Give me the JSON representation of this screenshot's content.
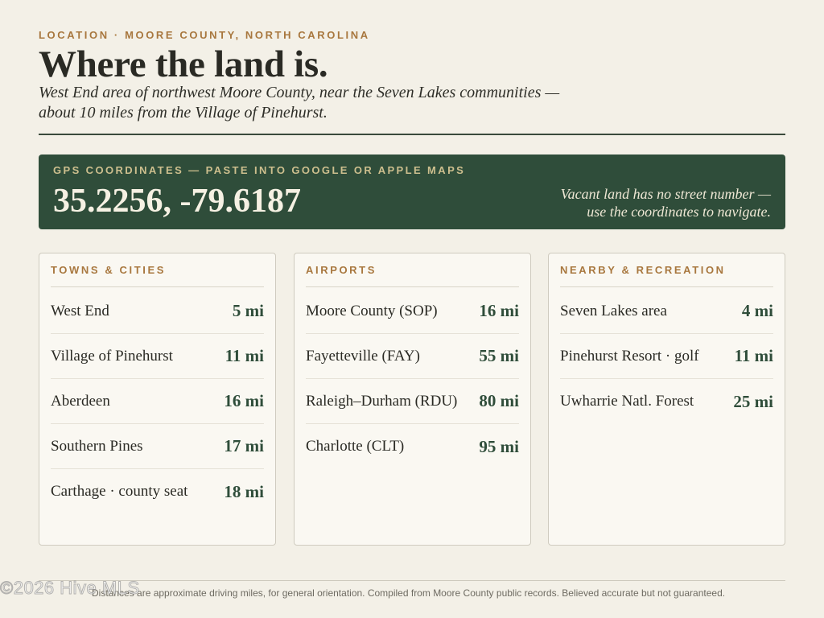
{
  "header": {
    "eyebrow": "LOCATION · MOORE COUNTY, NORTH CAROLINA",
    "title": "Where the land is.",
    "subtitle_line1": "West End area of northwest Moore County, near the Seven Lakes communities —",
    "subtitle_line2": "about 10 miles from the Village of Pinehurst."
  },
  "gps": {
    "label": "GPS COORDINATES — PASTE INTO GOOGLE OR APPLE MAPS",
    "coords": "35.2256, -79.6187",
    "note_line1": "Vacant land has no street number —",
    "note_line2": "use the coordinates to navigate."
  },
  "cards": [
    {
      "heading": "TOWNS & CITIES",
      "rows": [
        {
          "name": "West End",
          "dist": "5 mi"
        },
        {
          "name": "Village of Pinehurst",
          "dist": "11 mi"
        },
        {
          "name": "Aberdeen",
          "dist": "16 mi"
        },
        {
          "name": "Southern Pines",
          "dist": "17 mi"
        },
        {
          "name": "Carthage · county seat",
          "dist": "18 mi"
        }
      ]
    },
    {
      "heading": "AIRPORTS",
      "rows": [
        {
          "name": "Moore County (SOP)",
          "dist": "16 mi"
        },
        {
          "name": "Fayetteville (FAY)",
          "dist": "55 mi"
        },
        {
          "name": "Raleigh–Durham (RDU)",
          "dist": "80 mi"
        },
        {
          "name": "Charlotte (CLT)",
          "dist": "95 mi"
        }
      ]
    },
    {
      "heading": "NEARBY & RECREATION",
      "rows": [
        {
          "name": "Seven Lakes area",
          "dist": "4 mi"
        },
        {
          "name": "Pinehurst Resort · golf",
          "dist": "11 mi"
        },
        {
          "name": "Uwharrie Natl. Forest",
          "dist": "25 mi"
        }
      ]
    }
  ],
  "footer": {
    "note": "Distances are approximate driving miles, for general orientation.  Compiled from Moore County public records.  Believed accurate but not guaranteed.",
    "watermark": "©2026 Hive MLS"
  },
  "colors": {
    "accent_gold": "#a8773e",
    "brand_green": "#2f4d3a",
    "background": "#f3f0e7"
  }
}
